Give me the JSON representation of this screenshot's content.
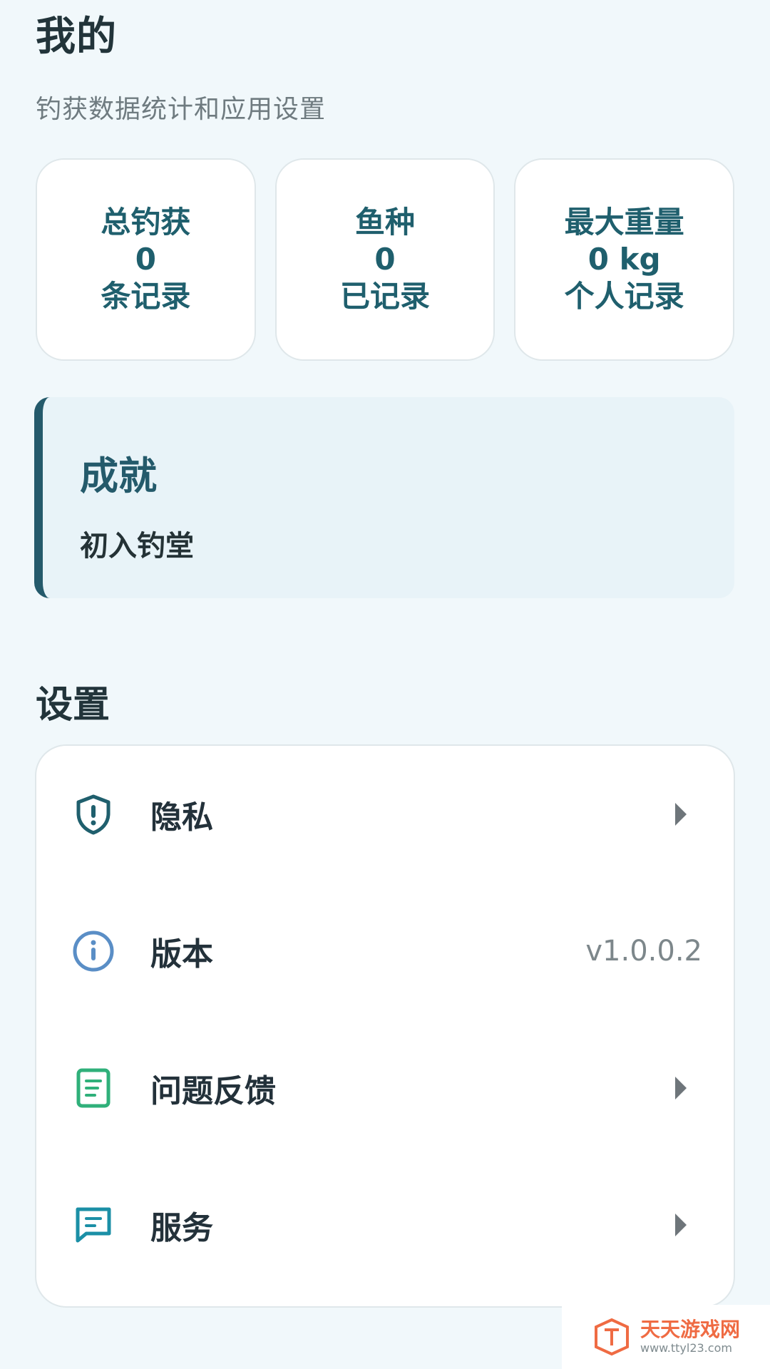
{
  "header": {
    "title": "我的",
    "subtitle": "钓获数据统计和应用设置"
  },
  "stats": [
    {
      "label": "总钓获",
      "value": "0",
      "caption": "条记录"
    },
    {
      "label": "鱼种",
      "value": "0",
      "caption": "已记录"
    },
    {
      "label": "最大重量",
      "value": "0 kg",
      "caption": "个人记录"
    }
  ],
  "achievement": {
    "title": "成就",
    "text": "初入钓堂"
  },
  "settings": {
    "title": "设置",
    "items": [
      {
        "label": "隐私",
        "icon": "shield-alert-icon",
        "value": ""
      },
      {
        "label": "版本",
        "icon": "info-icon",
        "value": "v1.0.0.2"
      },
      {
        "label": "问题反馈",
        "icon": "document-icon",
        "value": ""
      },
      {
        "label": "服务",
        "icon": "chat-icon",
        "value": ""
      }
    ]
  },
  "watermark": {
    "title": "天天游戏网",
    "url": "www.ttyl23.com"
  },
  "colors": {
    "background": "#f1f8fb",
    "primary": "#1f5f6d",
    "achievement_bar": "#245a6b",
    "info_icon": "#5a8ec6",
    "document_icon": "#2fb07a",
    "chat_icon": "#1b8fa6"
  }
}
